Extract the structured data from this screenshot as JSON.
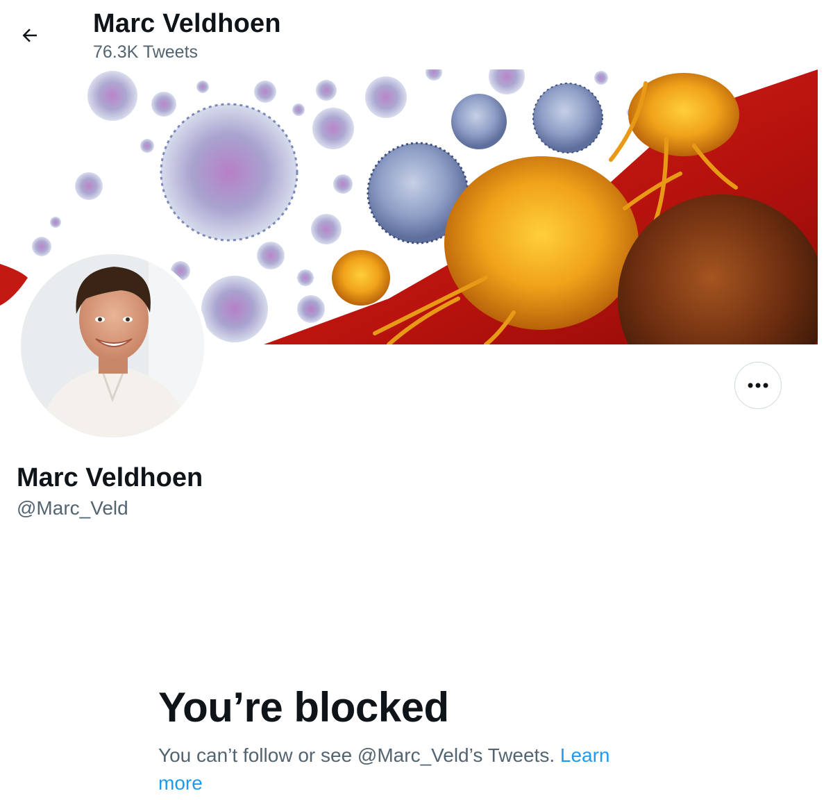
{
  "header": {
    "name": "Marc Veldhoen",
    "tweet_count": "76.3K Tweets"
  },
  "profile": {
    "name": "Marc Veldhoen",
    "handle": "@Marc_Veld"
  },
  "blocked": {
    "title": "You’re blocked",
    "message": "You can’t follow or see @Marc_Veld’s Tweets.",
    "link_text": "Learn more"
  },
  "icons": {
    "back": "arrow-left-icon",
    "more": "more-horizontal-icon"
  },
  "colors": {
    "link": "#1d9bf0",
    "text_primary": "#0f1419",
    "text_secondary": "#536471",
    "border": "#cfd9de"
  }
}
